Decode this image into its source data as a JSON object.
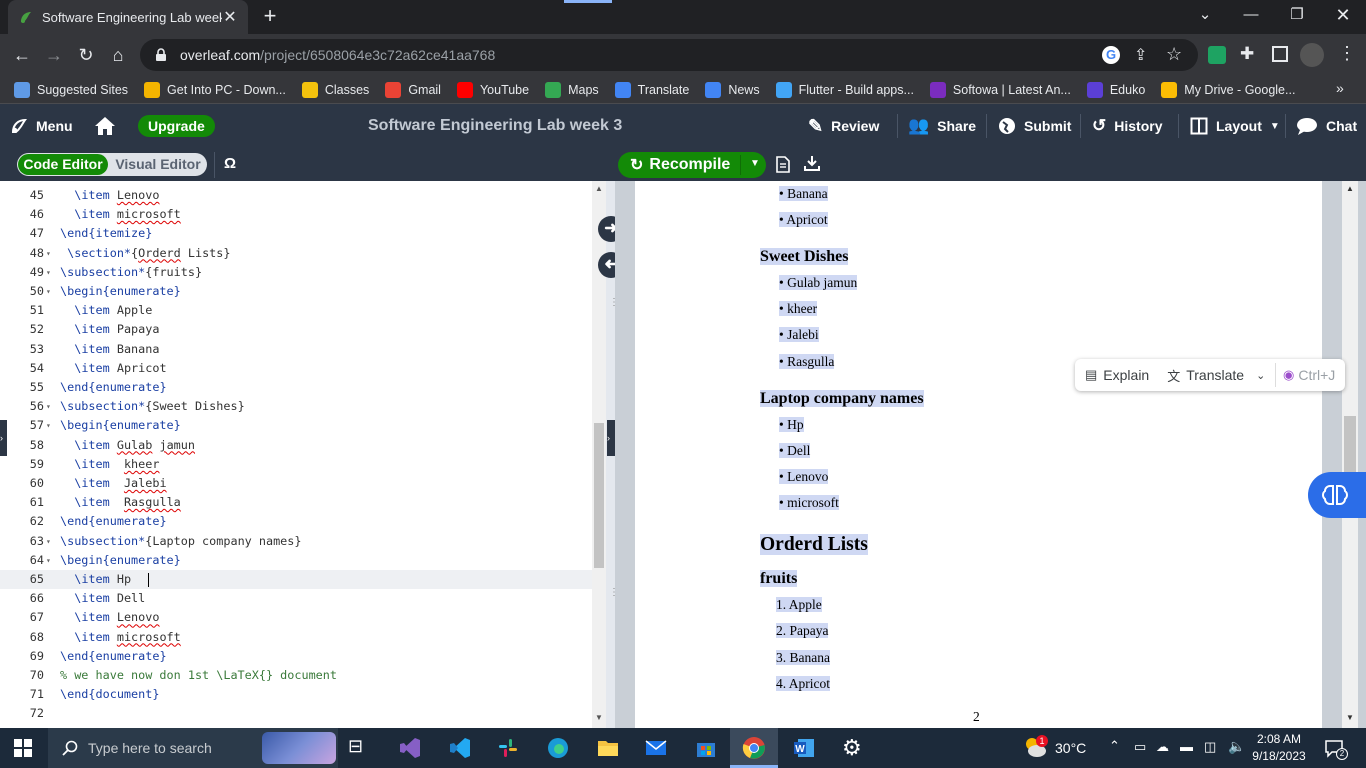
{
  "browser": {
    "tab_title": "Software Engineering Lab week 3",
    "url_host": "overleaf.com",
    "url_path": "/project/6508064e3c72a62ce41aa768",
    "bookmarks": [
      {
        "label": "Suggested Sites",
        "icon": "suggested-sites-icon",
        "color": "#5f9ae6"
      },
      {
        "label": "Get Into PC - Down...",
        "icon": "getintopc-icon",
        "color": "#f4b400"
      },
      {
        "label": "Classes",
        "icon": "classes-icon",
        "color": "#f4c20d"
      },
      {
        "label": "Gmail",
        "icon": "gmail-icon",
        "color": "#ea4335"
      },
      {
        "label": "YouTube",
        "icon": "youtube-icon",
        "color": "#ff0000"
      },
      {
        "label": "Maps",
        "icon": "maps-icon",
        "color": "#34a853"
      },
      {
        "label": "Translate",
        "icon": "translate-icon",
        "color": "#4285f4"
      },
      {
        "label": "News",
        "icon": "news-icon",
        "color": "#4285f4"
      },
      {
        "label": "Flutter - Build apps...",
        "icon": "flutter-icon",
        "color": "#42a5f5"
      },
      {
        "label": "Softowa | Latest An...",
        "icon": "softowa-icon",
        "color": "#7b2cbf"
      },
      {
        "label": "Eduko",
        "icon": "eduko-icon",
        "color": "#5b3fd6"
      },
      {
        "label": "My Drive - Google...",
        "icon": "drive-icon",
        "color": "#fbbc04"
      }
    ]
  },
  "toolbar": {
    "menu": "Menu",
    "upgrade": "Upgrade",
    "project_title": "Software Engineering Lab week 3",
    "review": "Review",
    "share": "Share",
    "submit": "Submit",
    "history": "History",
    "layout": "Layout",
    "chat": "Chat"
  },
  "editor_header": {
    "code_editor": "Code Editor",
    "visual_editor": "Visual Editor",
    "symbol": "Ω",
    "recompile": "Recompile"
  },
  "code_lines": [
    {
      "n": "45",
      "fold": false,
      "parts": [
        [
          "  ",
          ""
        ],
        [
          "\\item",
          "kw"
        ],
        [
          " ",
          ""
        ],
        [
          "Lenovo",
          "sp"
        ]
      ]
    },
    {
      "n": "46",
      "fold": false,
      "parts": [
        [
          "  ",
          ""
        ],
        [
          "\\item",
          "kw"
        ],
        [
          " ",
          ""
        ],
        [
          "microsoft",
          "sp"
        ]
      ]
    },
    {
      "n": "47",
      "fold": false,
      "parts": [
        [
          "\\end{",
          "kw"
        ],
        [
          "itemize",
          "kw"
        ],
        [
          "}",
          "kw"
        ]
      ]
    },
    {
      "n": "48",
      "fold": true,
      "parts": [
        [
          " ",
          ""
        ],
        [
          "\\section*",
          "kw"
        ],
        [
          "{",
          ""
        ],
        [
          "Orderd",
          "sp"
        ],
        [
          " Lists}",
          ""
        ]
      ]
    },
    {
      "n": "49",
      "fold": true,
      "parts": [
        [
          "\\subsection*",
          "kw"
        ],
        [
          "{fruits}",
          ""
        ]
      ]
    },
    {
      "n": "50",
      "fold": true,
      "parts": [
        [
          "\\begin{",
          "kw"
        ],
        [
          "enumerate",
          "kw"
        ],
        [
          "}",
          "kw"
        ]
      ]
    },
    {
      "n": "51",
      "fold": false,
      "parts": [
        [
          "  ",
          ""
        ],
        [
          "\\item",
          "kw"
        ],
        [
          " Apple",
          ""
        ]
      ]
    },
    {
      "n": "52",
      "fold": false,
      "parts": [
        [
          "  ",
          ""
        ],
        [
          "\\item",
          "kw"
        ],
        [
          " Papaya",
          ""
        ]
      ]
    },
    {
      "n": "53",
      "fold": false,
      "parts": [
        [
          "  ",
          ""
        ],
        [
          "\\item",
          "kw"
        ],
        [
          " Banana",
          ""
        ]
      ]
    },
    {
      "n": "54",
      "fold": false,
      "parts": [
        [
          "  ",
          ""
        ],
        [
          "\\item",
          "kw"
        ],
        [
          " Apricot",
          ""
        ]
      ]
    },
    {
      "n": "55",
      "fold": false,
      "parts": [
        [
          "\\end{",
          "kw"
        ],
        [
          "enumerate",
          "kw"
        ],
        [
          "}",
          "kw"
        ]
      ]
    },
    {
      "n": "56",
      "fold": true,
      "parts": [
        [
          "\\subsection*",
          "kw"
        ],
        [
          "{Sweet Dishes}",
          ""
        ]
      ]
    },
    {
      "n": "57",
      "fold": true,
      "parts": [
        [
          "\\begin{",
          "kw"
        ],
        [
          "enumerate",
          "kw"
        ],
        [
          "}",
          "kw"
        ]
      ]
    },
    {
      "n": "58",
      "fold": false,
      "parts": [
        [
          "  ",
          ""
        ],
        [
          "\\item",
          "kw"
        ],
        [
          " ",
          ""
        ],
        [
          "Gulab",
          "sp"
        ],
        [
          " ",
          ""
        ],
        [
          "jamun",
          "sp"
        ]
      ]
    },
    {
      "n": "59",
      "fold": false,
      "parts": [
        [
          "  ",
          ""
        ],
        [
          "\\item",
          "kw"
        ],
        [
          "  ",
          ""
        ],
        [
          "kheer",
          "sp"
        ]
      ]
    },
    {
      "n": "60",
      "fold": false,
      "parts": [
        [
          "  ",
          ""
        ],
        [
          "\\item",
          "kw"
        ],
        [
          "  ",
          ""
        ],
        [
          "Jalebi",
          "sp"
        ]
      ]
    },
    {
      "n": "61",
      "fold": false,
      "parts": [
        [
          "  ",
          ""
        ],
        [
          "\\item",
          "kw"
        ],
        [
          "  ",
          ""
        ],
        [
          "Rasgulla",
          "sp"
        ]
      ]
    },
    {
      "n": "62",
      "fold": false,
      "parts": [
        [
          "\\end{",
          "kw"
        ],
        [
          "enumerate",
          "kw"
        ],
        [
          "}",
          "kw"
        ]
      ]
    },
    {
      "n": "63",
      "fold": true,
      "parts": [
        [
          "\\subsection*",
          "kw"
        ],
        [
          "{Laptop company names}",
          ""
        ]
      ]
    },
    {
      "n": "64",
      "fold": true,
      "parts": [
        [
          "\\begin{",
          "kw"
        ],
        [
          "enumerate",
          "kw"
        ],
        [
          "}",
          "kw"
        ]
      ]
    },
    {
      "n": "65",
      "fold": false,
      "parts": [
        [
          "  ",
          ""
        ],
        [
          "\\item",
          "kw"
        ],
        [
          " Hp",
          ""
        ]
      ]
    },
    {
      "n": "66",
      "fold": false,
      "parts": [
        [
          "  ",
          ""
        ],
        [
          "\\item",
          "kw"
        ],
        [
          " Dell",
          ""
        ]
      ]
    },
    {
      "n": "67",
      "fold": false,
      "parts": [
        [
          "  ",
          ""
        ],
        [
          "\\item",
          "kw"
        ],
        [
          " ",
          ""
        ],
        [
          "Lenovo",
          "sp"
        ]
      ]
    },
    {
      "n": "68",
      "fold": false,
      "parts": [
        [
          "  ",
          ""
        ],
        [
          "\\item",
          "kw"
        ],
        [
          " ",
          ""
        ],
        [
          "microsoft",
          "sp"
        ]
      ]
    },
    {
      "n": "69",
      "fold": false,
      "parts": [
        [
          "\\end{",
          "kw"
        ],
        [
          "enumerate",
          "kw"
        ],
        [
          "}",
          "kw"
        ]
      ]
    },
    {
      "n": "70",
      "fold": false,
      "parts": [
        [
          "% we have now don 1st \\LaTeX{} document",
          "cm"
        ]
      ]
    },
    {
      "n": "71",
      "fold": false,
      "parts": [
        [
          "\\end{",
          "kw"
        ],
        [
          "document",
          "kw"
        ],
        [
          "}",
          "kw"
        ]
      ]
    },
    {
      "n": "72",
      "fold": false,
      "parts": []
    }
  ],
  "active_line": "65",
  "pdf": {
    "bullets_top": [
      "Banana",
      "Apricot"
    ],
    "sweet_heading": "Sweet Dishes",
    "sweet_items": [
      "Gulab jamun",
      "kheer",
      "Jalebi",
      "Rasgulla"
    ],
    "laptop_heading": "Laptop company names",
    "laptop_items": [
      "Hp",
      "Dell",
      "Lenovo",
      "microsoft"
    ],
    "ordered_heading": "Orderd Lists",
    "fruits_heading": "fruits",
    "fruits_items": [
      "Apple",
      "Papaya",
      "Banana",
      "Apricot"
    ],
    "page_number": "2"
  },
  "popup": {
    "explain": "Explain",
    "translate": "Translate",
    "shortcut": "Ctrl+J"
  },
  "taskbar": {
    "search_placeholder": "Type here to search",
    "temperature": "30°C",
    "time": "2:08 AM",
    "date": "9/18/2023",
    "notifications": "2",
    "weather_badge": "1"
  }
}
